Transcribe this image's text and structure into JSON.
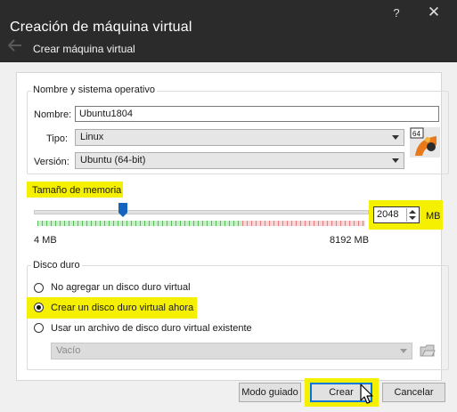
{
  "window": {
    "title": "Creación de máquina virtual",
    "subtitle": "Crear máquina virtual",
    "help_label": "?",
    "close_label": "✕"
  },
  "name_os": {
    "legend": "Nombre y sistema operativo",
    "name_label": "Nombre:",
    "name_value": "Ubuntu1804",
    "type_label": "Tipo:",
    "type_value": "Linux",
    "version_label": "Versión:",
    "version_value": "Ubuntu (64-bit)",
    "os_badge": "64"
  },
  "memory": {
    "label": "Tamaño de memoria",
    "value": "2048",
    "unit": "MB",
    "min_label": "4 MB",
    "max_label": "8192 MB",
    "min": 4,
    "max": 8192,
    "current": 2048
  },
  "disk": {
    "legend": "Disco duro",
    "options": [
      "No agregar un disco duro virtual",
      "Crear un disco duro virtual ahora",
      "Usar un archivo de disco duro virtual existente"
    ],
    "selected_index": 1,
    "file_value": "Vacío"
  },
  "buttons": {
    "guided": "Modo guiado",
    "create": "Crear",
    "cancel": "Cancelar"
  },
  "colors": {
    "highlight": "#f5ef00",
    "titlebar": "#2b2b2b",
    "accent": "#0078d7"
  }
}
